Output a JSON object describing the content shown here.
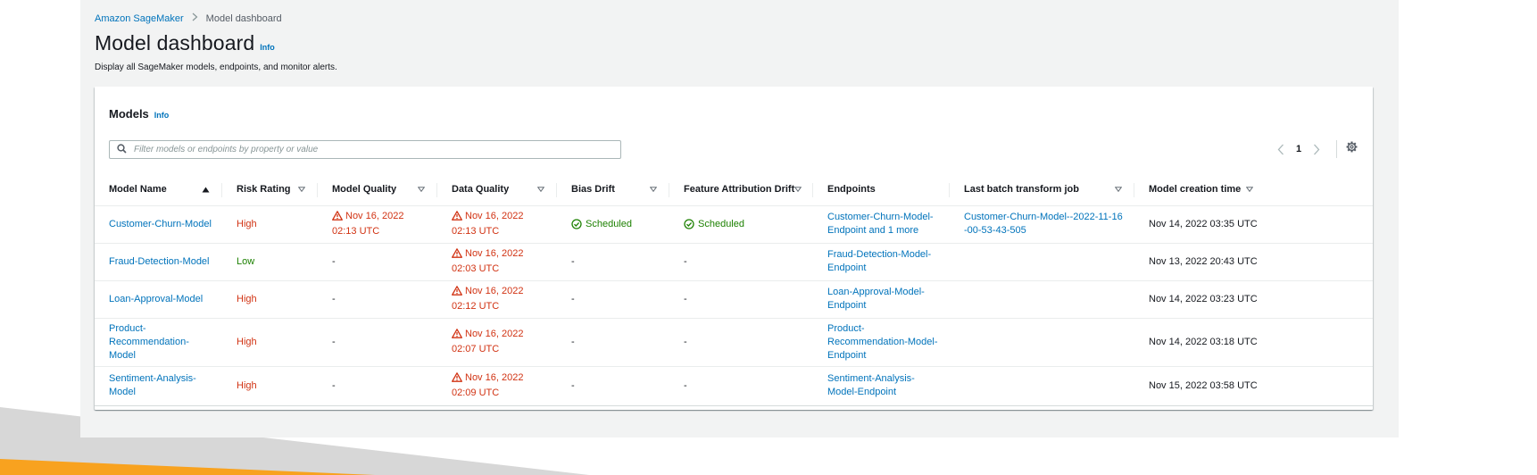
{
  "breadcrumb": {
    "root": "Amazon SageMaker",
    "current": "Model dashboard"
  },
  "page": {
    "title": "Model dashboard",
    "info": "Info",
    "description": "Display all SageMaker models, endpoints, and monitor alerts."
  },
  "panel": {
    "title": "Models",
    "info": "Info"
  },
  "search": {
    "placeholder": "Filter models or endpoints by property or value"
  },
  "pagination": {
    "current_page": "1"
  },
  "table": {
    "columns": [
      "Model Name",
      "Risk Rating",
      "Model Quality",
      "Data Quality",
      "Bias Drift",
      "Feature Attribution Drift",
      "Endpoints",
      "Last batch transform job",
      "Model creation time"
    ],
    "rows": [
      {
        "model_name": "Customer-Churn-Model",
        "risk": "High",
        "model_quality": "Nov 16, 2022 02:13 UTC",
        "data_quality": "Nov 16, 2022 02:13 UTC",
        "bias_drift": "Scheduled",
        "feature_drift": "Scheduled",
        "endpoint": "Customer-Churn-Model-Endpoint and 1 more",
        "batch_job": "Customer-Churn-Model--2022-11-16-00-53-43-505",
        "created": "Nov 14, 2022 03:35 UTC"
      },
      {
        "model_name": "Fraud-Detection-Model",
        "risk": "Low",
        "model_quality": "-",
        "data_quality": "Nov 16, 2022 02:03 UTC",
        "bias_drift": "-",
        "feature_drift": "-",
        "endpoint": "Fraud-Detection-Model-Endpoint",
        "batch_job": "",
        "created": "Nov 13, 2022 20:43 UTC"
      },
      {
        "model_name": "Loan-Approval-Model",
        "risk": "High",
        "model_quality": "-",
        "data_quality": "Nov 16, 2022 02:12 UTC",
        "bias_drift": "-",
        "feature_drift": "-",
        "endpoint": "Loan-Approval-Model-Endpoint",
        "batch_job": "",
        "created": "Nov 14, 2022 03:23 UTC"
      },
      {
        "model_name": "Product-Recommendation-Model",
        "risk": "High",
        "model_quality": "-",
        "data_quality": "Nov 16, 2022 02:07 UTC",
        "bias_drift": "-",
        "feature_drift": "-",
        "endpoint": "Product-Recommendation-Model-Endpoint",
        "batch_job": "",
        "created": "Nov 14, 2022 03:18 UTC"
      },
      {
        "model_name": "Sentiment-Analysis-Model",
        "risk": "High",
        "model_quality": "-",
        "data_quality": "Nov 16, 2022 02:09 UTC",
        "bias_drift": "-",
        "feature_drift": "-",
        "endpoint": "Sentiment-Analysis-Model-Endpoint",
        "batch_job": "",
        "created": "Nov 15, 2022 03:58 UTC"
      }
    ]
  },
  "colors": {
    "link": "#0073bb",
    "risk_high": "#d13212",
    "risk_low": "#1d8102",
    "alert": "#d13212",
    "scheduled": "#1d8102",
    "slide_orange": "#f89e1b",
    "slide_gray": "#d5d5d5"
  }
}
